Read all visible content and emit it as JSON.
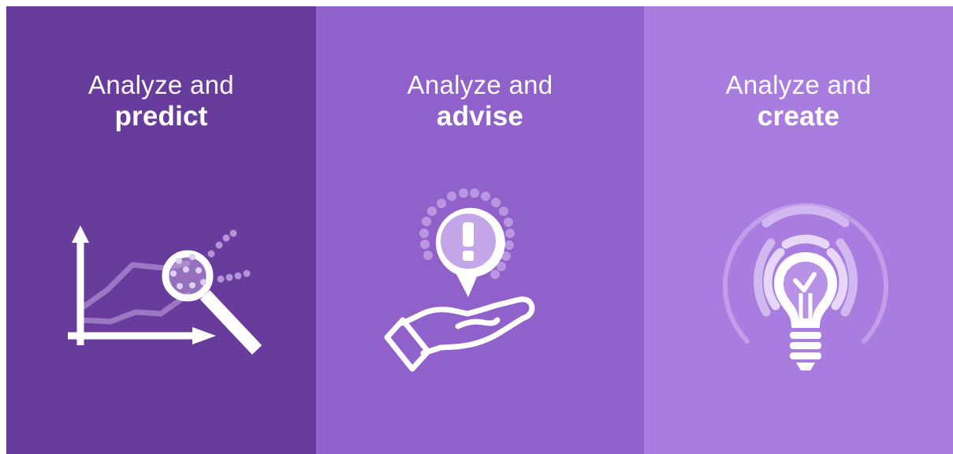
{
  "panels": [
    {
      "line1": "Analyze and",
      "line2": "predict",
      "background": "#683c9c",
      "icon": "chart-magnifier-icon"
    },
    {
      "line1": "Analyze and",
      "line2": "advise",
      "background": "#9060cb",
      "icon": "hand-speech-bubble-exclamation-icon"
    },
    {
      "line1": "Analyze and",
      "line2": "create",
      "background": "#a97ce0",
      "icon": "lightbulb-icon"
    }
  ]
}
